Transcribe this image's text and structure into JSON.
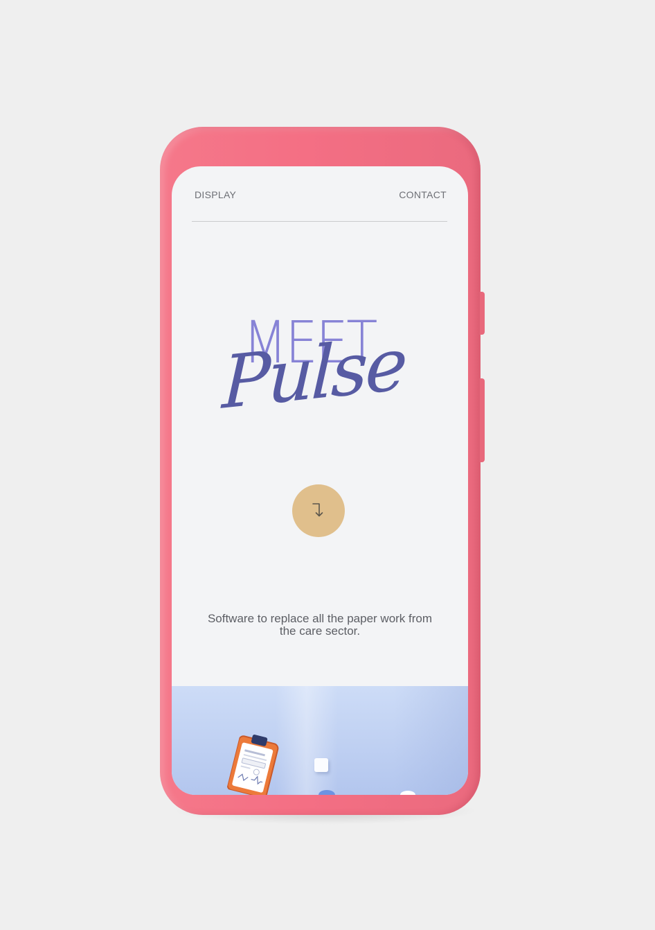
{
  "nav": {
    "display_label": "DISPLAY",
    "contact_label": "CONTACT"
  },
  "hero": {
    "meet_text": "MEET",
    "pulse_text": "Pulse",
    "scroll_button_icon": "arrow-turn-down-right-icon",
    "tagline": "Software to replace all the paper work from the care sector."
  },
  "colors": {
    "phone_case": "#f4788a",
    "screen_background": "#f3f4f6",
    "meet_text": "#8783d6",
    "pulse_text": "#575ba3",
    "scroll_button": "#e0bf8c",
    "tagline_text": "#5c5e64",
    "illustration_background": "#c3d3f3",
    "clipboard": "#ec7a3a"
  }
}
